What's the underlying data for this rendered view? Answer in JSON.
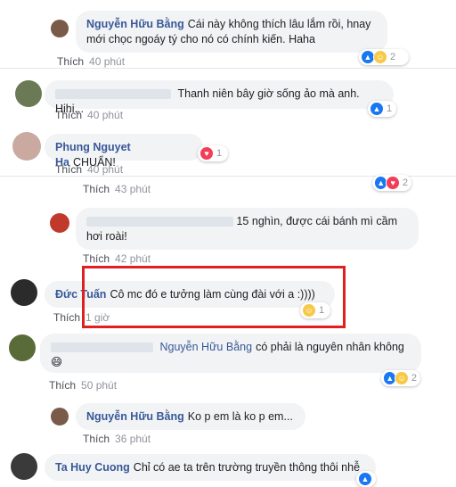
{
  "comments": [
    {
      "author": "Nguyễn Hữu Bằng",
      "text": "Cái này không thích lâu lắm rồi, hnay mới chọc ngoáy tý cho nó có chính kiến. Haha",
      "like": "Thích",
      "time": "40 phút",
      "count": "2"
    },
    {
      "author": "",
      "text": "Thanh niên bây giờ sống ảo mà anh. Hihi...",
      "like": "Thích",
      "time": "40 phút",
      "count": "1"
    },
    {
      "author": "Phung Nguyet Ha",
      "text": "CHUẨN!",
      "like": "Thích",
      "time": "40 phút",
      "count": "1"
    },
    {
      "author": "",
      "text": "",
      "like": "Thích",
      "time": "43 phút",
      "count": "2"
    },
    {
      "author": "",
      "text": "15 nghìn, được cái bánh mì cầm hơi roài!",
      "like": "Thích",
      "time": "42 phút",
      "count": ""
    },
    {
      "author": "Đức Tuấn",
      "text": "Cô mc đó e tưởng làm cùng đài với a :))))",
      "like": "Thích",
      "time": "1 giờ",
      "count": "1"
    },
    {
      "author": "",
      "mention": "Nguyễn Hữu Bằng",
      "text": "có phải là nguyên nhân không",
      "emoji": "😄",
      "like": "Thích",
      "time": "50 phút",
      "count": "2"
    },
    {
      "author": "Nguyễn Hữu Bằng",
      "text": "Ko p em là ko p em...",
      "like": "Thích",
      "time": "36 phút",
      "count": ""
    },
    {
      "author": "Ta Huy Cuong",
      "text": "Chỉ có ae ta trên trường truyền thông thôi nhễ",
      "like": "",
      "time": "",
      "count": ""
    }
  ],
  "colors": {
    "link": "#385898",
    "bubble": "#f2f3f5",
    "meta": "#90949c",
    "highlight": "#e02020"
  }
}
